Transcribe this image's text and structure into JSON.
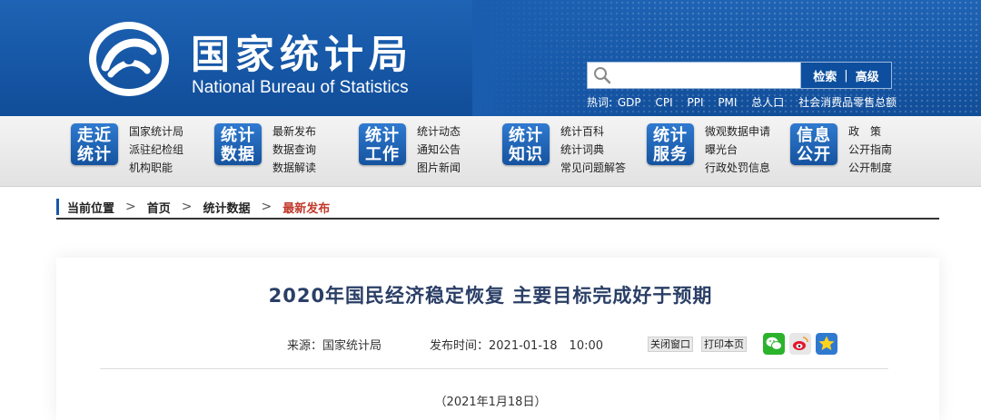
{
  "header": {
    "title_cn": "国家统计局",
    "title_en": "National Bureau of Statistics",
    "search": {
      "placeholder": "",
      "btn_search": "检索",
      "btn_sep": "|",
      "btn_advanced": "高级"
    },
    "hot": {
      "label": "热词:",
      "items": [
        "GDP",
        "CPI",
        "PPI",
        "PMI",
        "总人口",
        "社会消费品零售总额"
      ]
    }
  },
  "nav": [
    {
      "badge": [
        "走近",
        "统计"
      ],
      "links": [
        "国家统计局",
        "派驻纪检组",
        "机构职能"
      ]
    },
    {
      "badge": [
        "统计",
        "数据"
      ],
      "links": [
        "最新发布",
        "数据查询",
        "数据解读"
      ]
    },
    {
      "badge": [
        "统计",
        "工作"
      ],
      "links": [
        "统计动态",
        "通知公告",
        "图片新闻"
      ]
    },
    {
      "badge": [
        "统计",
        "知识"
      ],
      "links": [
        "统计百科",
        "统计词典",
        "常见问题解答"
      ]
    },
    {
      "badge": [
        "统计",
        "服务"
      ],
      "links": [
        "微观数据申请",
        "曝光台",
        "行政处罚信息"
      ]
    },
    {
      "badge": [
        "信息",
        "公开"
      ],
      "links": [
        "政　策",
        "公开指南",
        "公开制度"
      ]
    }
  ],
  "breadcrumb": {
    "label": "当前位置",
    "items": [
      "首页",
      "统计数据"
    ],
    "current": "最新发布",
    "arrow": ">"
  },
  "article": {
    "title": "2020年国民经济稳定恢复 主要目标完成好于预期",
    "source": "来源：国家统计局",
    "publish_time": "发布时间：2021-01-18　10:00",
    "close_window": "关闭窗口",
    "print_page": "打印本页",
    "date_line": "（2021年1月18日）"
  },
  "colors": {
    "header_blue": "#1657a6",
    "badge_blue": "#2f7ad0",
    "title_color": "#2a3e66",
    "current_red": "#c0392b"
  },
  "icons": {
    "logo": "nbs-logo-icon",
    "search": "search-icon",
    "wechat": "wechat-icon",
    "weibo": "weibo-icon",
    "favorite": "star-icon"
  }
}
